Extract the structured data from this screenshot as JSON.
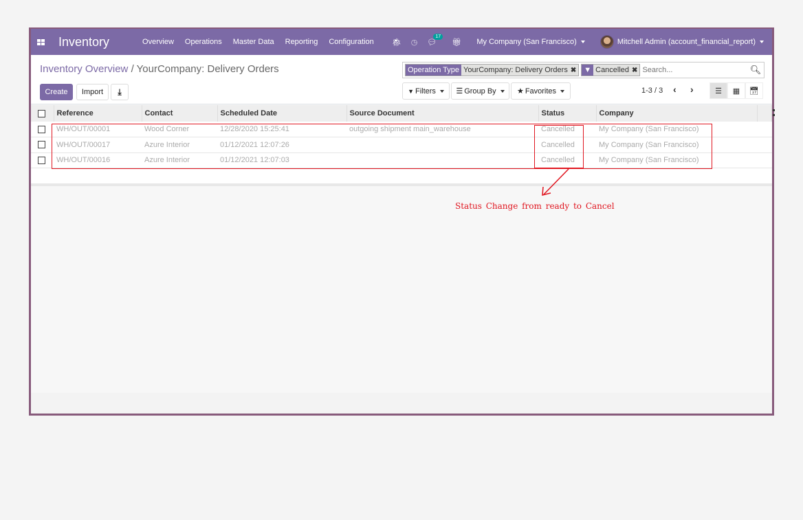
{
  "navbar": {
    "app_title": "Inventory",
    "menu": [
      "Overview",
      "Operations",
      "Master Data",
      "Reporting",
      "Configuration"
    ],
    "message_count": "17",
    "company": "My Company (San Francisco)",
    "user": "Mitchell Admin (account_financial_report)"
  },
  "breadcrumb": {
    "parent": "Inventory Overview",
    "separator": "/",
    "current": "YourCompany: Delivery Orders"
  },
  "buttons": {
    "create": "Create",
    "import": "Import"
  },
  "search": {
    "facets": [
      {
        "label": "Operation Type",
        "value": "YourCompany: Delivery Orders"
      },
      {
        "label": "filter-icon",
        "value": "Cancelled"
      }
    ],
    "placeholder": "Search..."
  },
  "search_options": {
    "filters": "Filters",
    "group_by": "Group By",
    "favorites": "Favorites"
  },
  "pager": {
    "value": "1-3 / 3"
  },
  "views": [
    "list",
    "kanban",
    "calendar"
  ],
  "table": {
    "columns": [
      "Reference",
      "Contact",
      "Scheduled Date",
      "Source Document",
      "Status",
      "Company"
    ],
    "rows": [
      {
        "reference": "WH/OUT/00001",
        "contact": "Wood Corner",
        "scheduled_date": "12/28/2020 15:25:41",
        "source_document": "outgoing shipment main_warehouse",
        "status": "Cancelled",
        "company": "My Company (San Francisco)"
      },
      {
        "reference": "WH/OUT/00017",
        "contact": "Azure Interior",
        "scheduled_date": "01/12/2021 12:07:26",
        "source_document": "",
        "status": "Cancelled",
        "company": "My Company (San Francisco)"
      },
      {
        "reference": "WH/OUT/00016",
        "contact": "Azure Interior",
        "scheduled_date": "01/12/2021 12:07:03",
        "source_document": "",
        "status": "Cancelled",
        "company": "My Company (San Francisco)"
      }
    ]
  },
  "annotation": {
    "text": "Status Change from ready to Cancel",
    "color": "#e0141e"
  },
  "colors": {
    "brand": "#7c6aa6",
    "frame": "#875a7b",
    "muted_text": "#aaaaaa"
  }
}
